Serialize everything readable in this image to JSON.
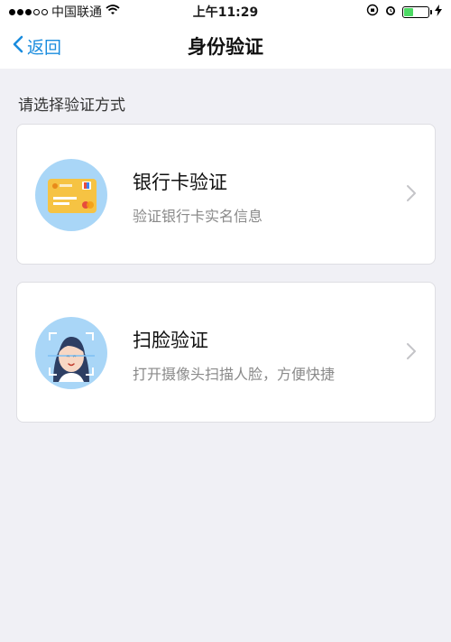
{
  "status_bar": {
    "carrier": "中国联通",
    "time": "上午11:29"
  },
  "nav": {
    "back_label": "返回",
    "title": "身份验证"
  },
  "section_label": "请选择验证方式",
  "options": [
    {
      "title": "银行卡验证",
      "subtitle": "验证银行卡实名信息",
      "icon": "bank-card-icon"
    },
    {
      "title": "扫脸验证",
      "subtitle": "打开摄像头扫描人脸，方便快捷",
      "icon": "face-scan-icon"
    }
  ],
  "colors": {
    "accent": "#1a8cde",
    "background": "#f0f0f5",
    "icon_circle": "#a9d6f7",
    "battery": "#4cd964"
  },
  "battery_level": 0.4
}
